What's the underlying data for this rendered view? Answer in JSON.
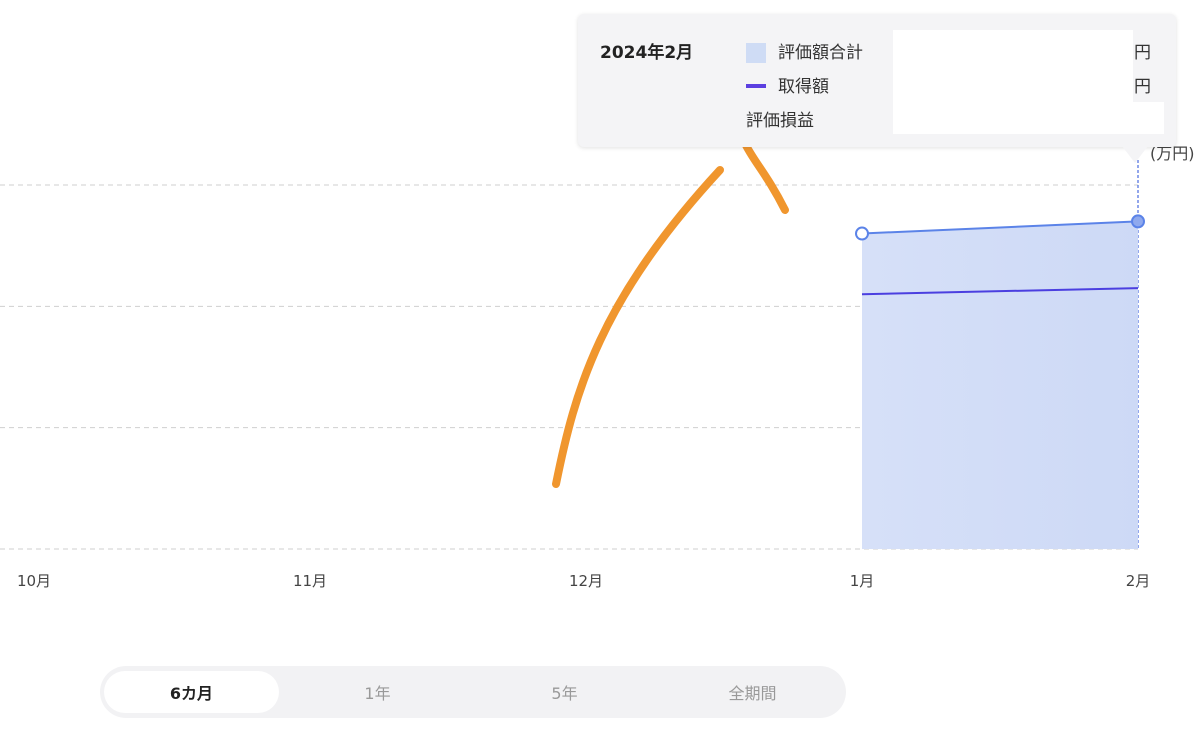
{
  "chart_data": {
    "type": "area",
    "unit": "(万円)",
    "categories": [
      "10月",
      "11月",
      "12月",
      "1月",
      "2月"
    ],
    "grid": true,
    "series": [
      {
        "name": "評価額合計",
        "style": "area",
        "color": "#5b83e8",
        "fill": "#d2ddf7",
        "points": [
          {
            "category": "1月",
            "value": 2.6
          },
          {
            "category": "2月",
            "value": 2.7
          }
        ]
      },
      {
        "name": "取得額",
        "style": "line",
        "color": "#4b3fe0",
        "points": [
          {
            "category": "1月",
            "value": 2.1
          },
          {
            "category": "2月",
            "value": 2.15
          }
        ]
      }
    ],
    "ylim": [
      0,
      3
    ],
    "hovered_category": "2月"
  },
  "tooltip": {
    "date": "2024年2月",
    "rows": [
      {
        "label": "評価額合計",
        "swatch": "area",
        "unit": "円"
      },
      {
        "label": "取得額",
        "swatch": "line",
        "unit": "円"
      },
      {
        "label": "評価損益",
        "swatch": "none"
      }
    ]
  },
  "period_tabs": [
    {
      "label": "6カ月",
      "active": true
    },
    {
      "label": "1年",
      "active": false
    },
    {
      "label": "5年",
      "active": false
    },
    {
      "label": "全期間",
      "active": false
    }
  ],
  "colors": {
    "accent": "#5b83e8",
    "acquisition_line": "#4b3fe0",
    "area_fill": "#d2ddf7",
    "annotation": "#f0962e"
  }
}
